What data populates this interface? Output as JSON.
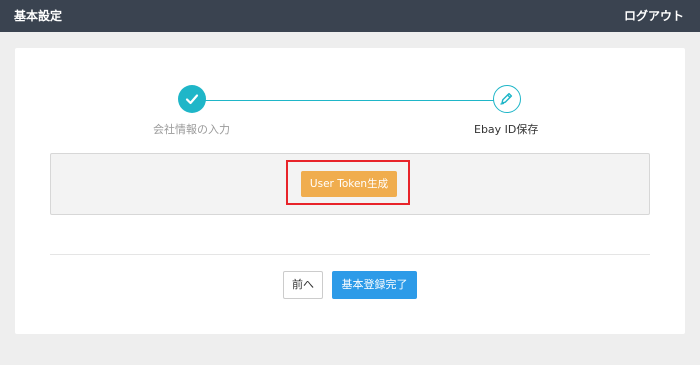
{
  "header": {
    "title": "基本設定",
    "logout_label": "ログアウト"
  },
  "stepper": {
    "steps": [
      {
        "label": "会社情報の入力",
        "status": "completed",
        "icon": "check-icon"
      },
      {
        "label": "Ebay ID保存",
        "status": "current",
        "icon": "pencil-icon"
      }
    ]
  },
  "token": {
    "button_label": "User Token生成"
  },
  "footer": {
    "back_label": "前へ",
    "complete_label": "基本登録完了"
  },
  "colors": {
    "header_bg": "#3a4350",
    "accent_teal": "#1fb6c8",
    "token_button": "#f0ad4e",
    "primary_button": "#2d9be8",
    "highlight_border": "#e8242a"
  }
}
